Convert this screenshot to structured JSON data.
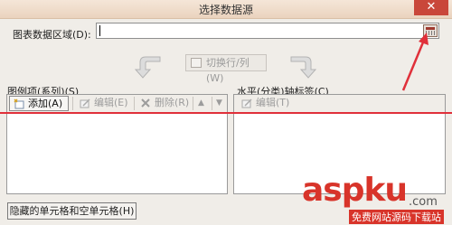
{
  "window": {
    "title": "选择数据源",
    "close_glyph": "✕"
  },
  "chart_range": {
    "label": "图表数据区域(D):",
    "value": ""
  },
  "switch_button": {
    "label": "切换行/列(W)"
  },
  "legend": {
    "label": "图例项(系列)(S)",
    "toolbar": {
      "add": "添加(A)",
      "edit": "编辑(E)",
      "delete": "删除(R)",
      "up_glyph": "▲",
      "down_glyph": "▼"
    },
    "items": []
  },
  "axis": {
    "label": "水平(分类)轴标签(C)",
    "toolbar": {
      "edit": "编辑(T)"
    },
    "items": []
  },
  "hidden_cells_button": {
    "label": "隐藏的单元格和空单元格(H)"
  },
  "watermark": {
    "main": "aspku",
    "sub": ".com",
    "tag": "免费网站源码下载站"
  },
  "colors": {
    "accent_red": "#e0303a",
    "close_red": "#c9473a"
  }
}
